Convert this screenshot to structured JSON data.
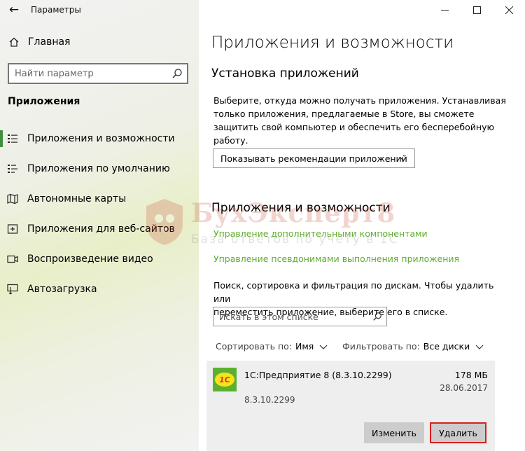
{
  "window": {
    "title": "Параметры",
    "back_glyph": "←",
    "controls": [
      "minimize-icon",
      "maximize-icon",
      "close-icon"
    ]
  },
  "sidebar": {
    "home_label": "Главная",
    "search_placeholder": "Найти параметр",
    "section_label": "Приложения",
    "items": [
      {
        "label": "Приложения и возможности",
        "icon": "apps-features-icon",
        "active": true
      },
      {
        "label": "Приложения по умолчанию",
        "icon": "default-apps-icon",
        "active": false
      },
      {
        "label": "Автономные карты",
        "icon": "offline-maps-icon",
        "active": false
      },
      {
        "label": "Приложения для веб-сайтов",
        "icon": "apps-websites-icon",
        "active": false
      },
      {
        "label": "Воспроизведение видео",
        "icon": "video-playback-icon",
        "active": false
      },
      {
        "label": "Автозагрузка",
        "icon": "startup-icon",
        "active": false
      }
    ],
    "accent_color": "#3e8f3e"
  },
  "main": {
    "title": "Приложения и возможности",
    "install_section": {
      "title": "Установка приложений",
      "description_lines": [
        "Выберите, откуда можно получать приложения. Устанавливая",
        "только приложения, предлагаемые в Store, вы сможете",
        "защитить свой компьютер и обеспечить его бесперебойную",
        "работу."
      ],
      "dropdown_value": "Показывать рекомендации приложений"
    },
    "apps_section": {
      "title": "Приложения и возможности",
      "links": [
        "Управление дополнительными компонентами",
        "Управление псевдонимами выполнения приложения"
      ],
      "link_color": "#5fae2e",
      "description_lines": [
        "Поиск, сортировка и фильтрация по дискам. Чтобы удалить или",
        "переместить приложение, выберите его в списке."
      ],
      "search_placeholder": "Искать в этом списке",
      "sort_label": "Сортировать по:",
      "sort_value": "Имя",
      "filter_label": "Фильтровать по:",
      "filter_value": "Все диски"
    },
    "app": {
      "name": "1С:Предприятие 8 (8.3.10.2299)",
      "size": "178 МБ",
      "date": "28.06.2017",
      "version": "8.3.10.2299",
      "logo_text": "1С",
      "modify_label": "Изменить",
      "delete_label": "Удалить",
      "highlight_color": "#d42020"
    }
  },
  "watermark": {
    "title": "БухЭксперт8",
    "subtitle": "База ответов по учету в 1С"
  }
}
